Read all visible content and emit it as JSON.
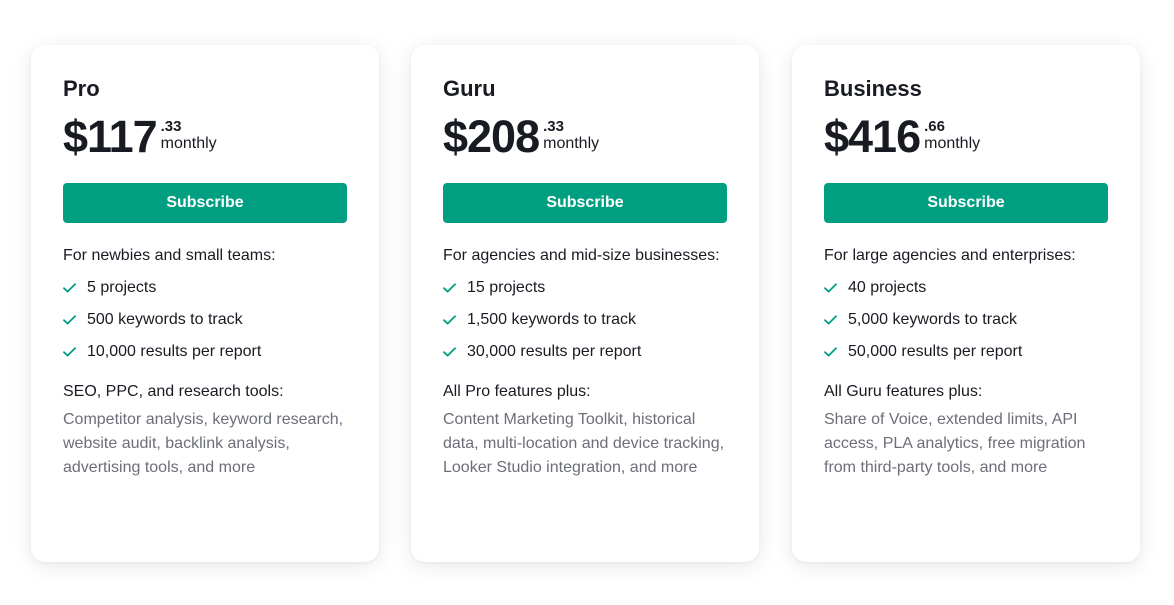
{
  "plans": [
    {
      "name": "Pro",
      "price_main": "$117",
      "price_cents": ".33",
      "period": "monthly",
      "cta": "Subscribe",
      "audience": "For newbies and small teams:",
      "features": [
        "5 projects",
        "500 keywords to track",
        "10,000 results per report"
      ],
      "section_title": "SEO, PPC, and research tools:",
      "section_desc": "Competitor analysis, keyword research, website audit, backlink analysis, advertising tools, and more"
    },
    {
      "name": "Guru",
      "price_main": "$208",
      "price_cents": ".33",
      "period": "monthly",
      "cta": "Subscribe",
      "audience": "For agencies and mid-size businesses:",
      "features": [
        "15 projects",
        "1,500 keywords to track",
        "30,000 results per report"
      ],
      "section_title": "All Pro features plus:",
      "section_desc": "Content Marketing Toolkit, historical data, multi-location and device tracking, Looker Studio integration, and more"
    },
    {
      "name": "Business",
      "price_main": "$416",
      "price_cents": ".66",
      "period": "monthly",
      "cta": "Subscribe",
      "audience": "For large agencies and enterprises:",
      "features": [
        "40 projects",
        "5,000 keywords to track",
        "50,000 results per report"
      ],
      "section_title": "All Guru features plus:",
      "section_desc": "Share of Voice, extended limits, API access, PLA analytics, free migration from third-party tools, and more"
    }
  ],
  "icons": {
    "feature_bullet": "check-icon"
  },
  "colors": {
    "accent": "#009f81",
    "text": "#191b23",
    "muted": "#6c6e79",
    "background": "#ffffff"
  }
}
